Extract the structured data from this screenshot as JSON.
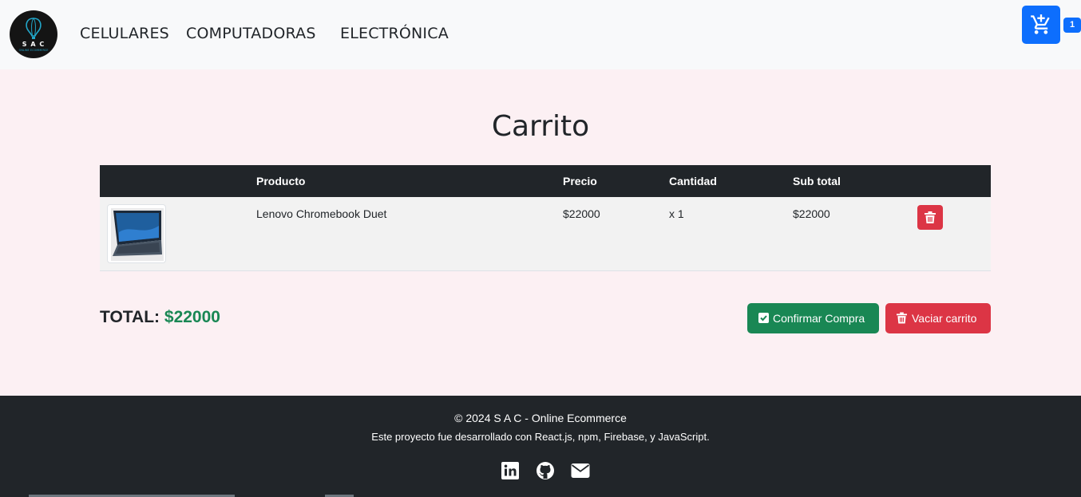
{
  "nav": {
    "logo_text": "S A C",
    "logo_sub": "ONLINE ECOMMERCE",
    "links": [
      "CELULARES",
      "COMPUTADORAS",
      "ELECTRÓNICA"
    ],
    "cart_count": "1"
  },
  "page": {
    "title": "Carrito"
  },
  "table": {
    "headers": [
      "",
      "Producto",
      "Precio",
      "Cantidad",
      "Sub total",
      ""
    ],
    "rows": [
      {
        "product": "Lenovo Chromebook Duet",
        "price": "$22000",
        "quantity": "x 1",
        "subtotal": "$22000"
      }
    ]
  },
  "summary": {
    "total_label": "TOTAL:",
    "total_value": "$22000",
    "confirm_label": "Confirmar Compra",
    "empty_label": "Vaciar carrito"
  },
  "footer": {
    "copyright": "© 2024 S A C - Online Ecommerce",
    "description": "Este proyecto fue desarrollado con React.js, npm, Firebase, y JavaScript.",
    "icons": [
      "linkedin-icon",
      "github-icon",
      "envelope-icon"
    ]
  },
  "colors": {
    "primary": "#0d6efd",
    "success": "#198754",
    "danger": "#dc3545",
    "dark": "#212529",
    "background": "#fcf0f3"
  }
}
